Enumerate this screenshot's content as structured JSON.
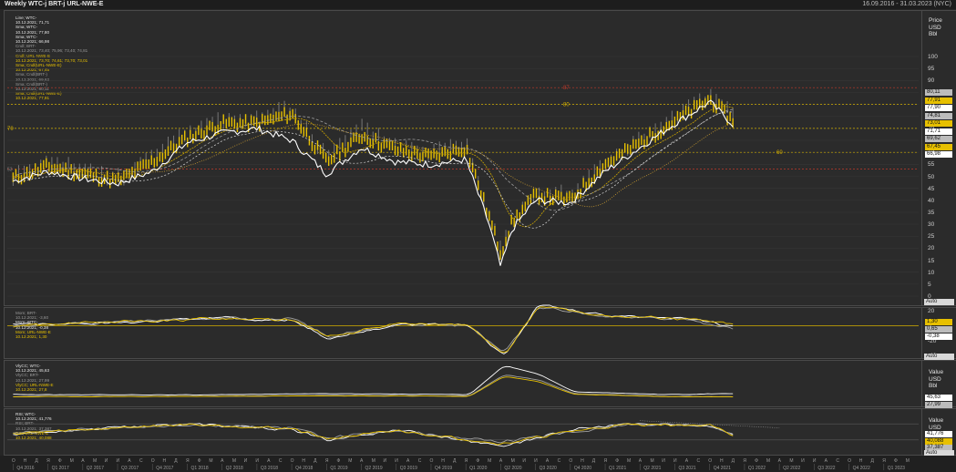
{
  "header": {
    "title": "Weekly WTC-j BRT-j URL-NWE-E",
    "date_range": "16.09.2016 - 31.03.2023 (NYC)"
  },
  "colors": {
    "background": "#262626",
    "wtc_line": "#ffffff",
    "brt_line": "#a0a0a0",
    "url_line": "#e7c000",
    "level_red": "#c0392b",
    "level_yellow": "#d4b000"
  },
  "main_legend": [
    {
      "text": "Line; WTC-",
      "cls": "w"
    },
    {
      "text": "10.12.2021; 71,71",
      "cls": "w"
    },
    {
      "text": "Sma; WTC-",
      "cls": "w"
    },
    {
      "text": "10.12.2021; 77,80",
      "cls": "w"
    },
    {
      "text": "Sma; WTC-",
      "cls": "w"
    },
    {
      "text": "10.12.2021; 66,98",
      "cls": "w"
    },
    {
      "text": "Cndl; BRT-",
      "cls": "g"
    },
    {
      "text": "10.12.2021; 73,40; 75,96; 73,40; 74,81",
      "cls": "g"
    },
    {
      "text": "Cndl; URL-NWE-E",
      "cls": "y"
    },
    {
      "text": "10.12.2021; 73,70; 74,61; 73,70; 73,01",
      "cls": "y"
    },
    {
      "text": "Sma; Cndl(URL-NWE-E)",
      "cls": "y"
    },
    {
      "text": "10.12.2021; 67,45",
      "cls": "y"
    },
    {
      "text": "Sma; Cndl(BRT-)",
      "cls": "g"
    },
    {
      "text": "10.12.2021; 69,62",
      "cls": "g"
    },
    {
      "text": "Sma; Cndl(BRT-)",
      "cls": "g"
    },
    {
      "text": "10.12.2021; 80,11",
      "cls": "g"
    },
    {
      "text": "Sma; Cndl(URL-NWE-E)",
      "cls": "y"
    },
    {
      "text": "10.12.2021; 77,91",
      "cls": "y"
    }
  ],
  "main_axis": {
    "unit_lines": [
      "Price",
      "USD",
      "Bbl"
    ],
    "ticks": [
      "100",
      "95",
      "90",
      "85",
      "80",
      "75",
      "70",
      "65",
      "60",
      "55",
      "50",
      "45",
      "40",
      "35",
      "30",
      "25",
      "20",
      "15",
      "10",
      "5",
      "0"
    ],
    "tags": [
      {
        "label": "80,11",
        "bg": "#bcbcbc",
        "fg": "#111111"
      },
      {
        "label": "77,91",
        "bg": "#e7c000",
        "fg": "#111111"
      },
      {
        "label": "77,90",
        "bg": "#ffffff",
        "fg": "#111111"
      },
      {
        "label": "74,81",
        "bg": "#bcbcbc",
        "fg": "#111111"
      },
      {
        "label": "73,01",
        "bg": "#e7c000",
        "fg": "#111111"
      },
      {
        "label": "71,71",
        "bg": "#ffffff",
        "fg": "#111111"
      },
      {
        "label": "69,62",
        "bg": "#bcbcbc",
        "fg": "#111111"
      },
      {
        "label": "67,45",
        "bg": "#e7c000",
        "fg": "#111111"
      },
      {
        "label": "66,98",
        "bg": "#ffffff",
        "fg": "#111111"
      }
    ],
    "auto_label": "Auto"
  },
  "level_labels": {
    "l87": "87",
    "l80": "80",
    "l60": "60",
    "left70": "70",
    "left53": "53"
  },
  "mom_panel": {
    "legend": [
      {
        "text": "Mom; BRT-",
        "cls": "g"
      },
      {
        "text": "10.12.2021; -3,60",
        "cls": "g"
      },
      {
        "text": "Mom; WTC-",
        "cls": "w"
      },
      {
        "text": "10.12.2021; -0,38",
        "cls": "w"
      },
      {
        "text": "Mom; URL-NWE-E",
        "cls": "y"
      },
      {
        "text": "10.12.2021; 1,30",
        "cls": "y"
      }
    ],
    "ticks": [
      "20",
      "0",
      "-20",
      "-40"
    ],
    "tags": [
      {
        "label": "1,30",
        "bg": "#e7c000",
        "fg": "#111111"
      },
      {
        "label": "0,65",
        "bg": "#bcbcbc",
        "fg": "#111111"
      },
      {
        "label": "-0,38",
        "bg": "#ffffff",
        "fg": "#111111"
      }
    ],
    "auto_label": "Auto"
  },
  "vlty_panel": {
    "legend": [
      {
        "text": "VlyCC; WTC-",
        "cls": "w"
      },
      {
        "text": "10.12.2021; 45,63",
        "cls": "w"
      },
      {
        "text": "VlyCC; BRT-",
        "cls": "g"
      },
      {
        "text": "10.12.2021; 27,99",
        "cls": "g"
      },
      {
        "text": "VlyCC; URL-NWE-E",
        "cls": "y"
      },
      {
        "text": "10.12.2021; 27,8",
        "cls": "y"
      }
    ],
    "unit_lines": [
      "Value",
      "USD",
      "Bbl"
    ],
    "tags": [
      {
        "label": "45,63",
        "bg": "#ffffff",
        "fg": "#111111"
      },
      {
        "label": "27,99",
        "bg": "#bcbcbc",
        "fg": "#111111"
      }
    ]
  },
  "rsi_panel": {
    "legend": [
      {
        "text": "RSI; WTC-",
        "cls": "w"
      },
      {
        "text": "10.12.2021; 41,776",
        "cls": "w"
      },
      {
        "text": "RSI; BRT-",
        "cls": "g"
      },
      {
        "text": "10.12.2021; 37,387",
        "cls": "g"
      },
      {
        "text": "RSI; URL-NWE-E",
        "cls": "y"
      },
      {
        "text": "10.12.2021; 40,088",
        "cls": "y"
      }
    ],
    "unit_lines": [
      "Value",
      "USD"
    ],
    "tags": [
      {
        "label": "41,776",
        "bg": "#ffffff",
        "fg": "#111111"
      },
      {
        "label": "40,088",
        "bg": "#e7c000",
        "fg": "#111111"
      },
      {
        "label": "37,387",
        "bg": "#bcbcbc",
        "fg": "#111111"
      }
    ],
    "auto_label": "Auto"
  },
  "time_axis": {
    "months": [
      "О",
      "Н",
      "Д",
      "Я",
      "Ф",
      "М",
      "А",
      "М",
      "И",
      "И",
      "А",
      "С",
      "О",
      "Н",
      "Д",
      "Я",
      "Ф",
      "М",
      "А",
      "М",
      "И",
      "И",
      "А",
      "С",
      "О",
      "Н",
      "Д",
      "Я",
      "Ф",
      "М",
      "А",
      "М",
      "И",
      "И",
      "А",
      "С",
      "О",
      "Н",
      "Д",
      "Я",
      "Ф",
      "М",
      "А",
      "М",
      "И",
      "И",
      "А",
      "С",
      "О",
      "Н",
      "Д",
      "Я",
      "Ф",
      "М",
      "А",
      "М",
      "И",
      "И",
      "А",
      "С",
      "О",
      "Н",
      "Д",
      "Я",
      "Ф",
      "М",
      "А",
      "М",
      "И",
      "И",
      "А",
      "С",
      "О",
      "Н",
      "Д",
      "Я",
      "Ф",
      "М",
      "А",
      "М",
      "И",
      "И",
      "А",
      "С",
      "О",
      "Н",
      "Д",
      "Я",
      "Ф",
      "М",
      "А",
      "М",
      "И",
      "И",
      "А",
      "С",
      "О",
      "Н",
      "Д"
    ],
    "quarters": [
      "Q4 2016",
      "Q1 2017",
      "Q2 2017",
      "Q3 2017",
      "Q4 2017",
      "Q1 2018",
      "Q2 2018",
      "Q3 2018",
      "Q4 2018",
      "Q1 2019",
      "Q2 2019",
      "Q3 2019",
      "Q4 2019",
      "Q1 2020",
      "Q2 2020",
      "Q3 2020",
      "Q4 2020",
      "Q1 2021",
      "Q2 2021",
      "Q3 2021",
      "Q4 2021",
      "Q1 2022",
      "Q2 2022",
      "Q3 2022",
      "Q4 2022",
      "Q1 2023"
    ]
  },
  "chart_data": [
    {
      "type": "line",
      "title": "Weekly WTC-j BRT-j URL-NWE-E",
      "ylabel": "Price USD Bbl",
      "ylim": [
        0,
        100
      ],
      "reference_levels": [
        87,
        80,
        70,
        60,
        53
      ],
      "x": [
        "2016-10",
        "2017-01",
        "2017-04",
        "2017-07",
        "2017-10",
        "2018-01",
        "2018-04",
        "2018-07",
        "2018-10",
        "2019-01",
        "2019-04",
        "2019-07",
        "2019-10",
        "2020-01",
        "2020-03",
        "2020-04",
        "2020-05",
        "2020-07",
        "2020-10",
        "2021-01",
        "2021-04",
        "2021-07",
        "2021-10",
        "2021-12"
      ],
      "series": [
        {
          "name": "WTC-",
          "values": [
            48,
            52,
            49,
            47,
            52,
            64,
            68,
            70,
            65,
            51,
            62,
            56,
            55,
            57,
            30,
            12,
            28,
            40,
            39,
            52,
            62,
            72,
            81,
            71.71
          ]
        },
        {
          "name": "BRT-",
          "values": [
            50,
            55,
            53,
            49,
            58,
            68,
            74,
            74,
            78,
            58,
            70,
            63,
            60,
            64,
            35,
            22,
            33,
            43,
            42,
            56,
            65,
            74,
            84,
            74.81
          ]
        },
        {
          "name": "URL-NWE-E",
          "values": [
            49,
            54,
            51,
            48,
            56,
            66,
            72,
            72,
            76,
            56,
            67,
            61,
            58,
            62,
            33,
            18,
            31,
            42,
            40,
            55,
            64,
            73,
            82,
            73.01
          ]
        }
      ]
    },
    {
      "type": "line",
      "title": "Mom",
      "ylim": [
        -40,
        20
      ],
      "x": [
        "2016-10",
        "2017-07",
        "2018-04",
        "2018-10",
        "2019-01",
        "2019-07",
        "2020-01",
        "2020-04",
        "2020-07",
        "2021-01",
        "2021-07",
        "2021-12"
      ],
      "series": [
        {
          "name": "BRT-",
          "values": [
            0,
            5,
            10,
            8,
            -15,
            3,
            0,
            -38,
            25,
            12,
            10,
            -3.6
          ]
        },
        {
          "name": "WTC-",
          "values": [
            1,
            4,
            11,
            6,
            -17,
            2,
            2,
            -42,
            28,
            14,
            11,
            -0.38
          ]
        },
        {
          "name": "URL-NWE-E",
          "values": [
            1,
            5,
            10,
            7,
            -16,
            3,
            1,
            -40,
            26,
            13,
            10,
            1.3
          ]
        }
      ]
    },
    {
      "type": "line",
      "title": "VlyCC",
      "x": [
        "2016-10",
        "2018-01",
        "2019-01",
        "2020-01",
        "2020-04",
        "2020-07",
        "2020-10",
        "2021-06",
        "2021-12"
      ],
      "series": [
        {
          "name": "WTC-",
          "values": [
            40,
            38,
            45,
            40,
            200,
            150,
            55,
            40,
            45.63
          ]
        },
        {
          "name": "BRT-",
          "values": [
            30,
            30,
            35,
            32,
            150,
            120,
            45,
            30,
            27.99
          ]
        },
        {
          "name": "URL-NWE-E",
          "values": [
            28,
            29,
            33,
            30,
            140,
            110,
            42,
            28,
            27.8
          ]
        }
      ]
    },
    {
      "type": "line",
      "title": "RSI",
      "x": [
        "2016-10",
        "2017-06",
        "2018-01",
        "2018-10",
        "2019-01",
        "2019-07",
        "2020-04",
        "2020-10",
        "2021-03",
        "2021-10",
        "2021-12"
      ],
      "series": [
        {
          "name": "WTC-",
          "values": [
            45,
            60,
            70,
            55,
            30,
            55,
            15,
            55,
            70,
            65,
            41.776
          ]
        },
        {
          "name": "BRT-",
          "values": [
            48,
            58,
            68,
            60,
            35,
            52,
            25,
            50,
            68,
            67,
            37.387
          ]
        },
        {
          "name": "URL-NWE-E",
          "values": [
            46,
            59,
            69,
            58,
            33,
            53,
            20,
            52,
            69,
            66,
            40.088
          ]
        }
      ]
    }
  ]
}
